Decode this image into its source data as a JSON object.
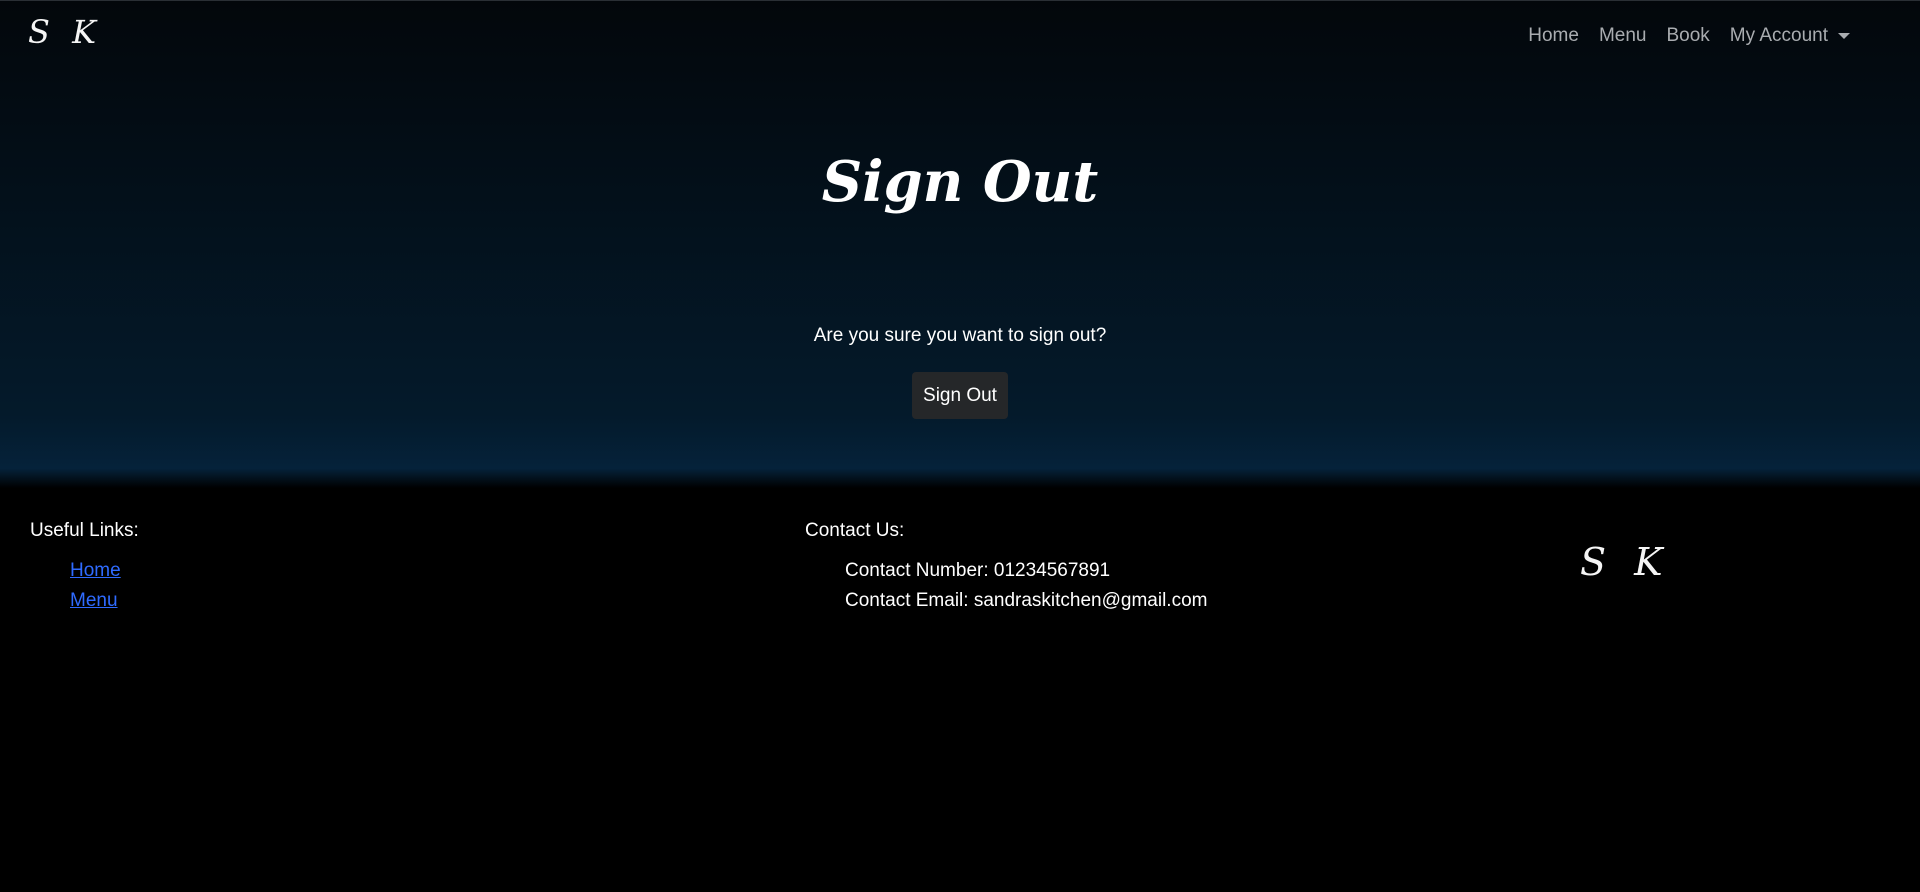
{
  "navbar": {
    "brand": "S K",
    "links": [
      "Home",
      "Menu",
      "Book"
    ],
    "account_label": "My Account"
  },
  "main": {
    "title": "Sign Out",
    "question": "Are you sure you want to sign out?",
    "button_label": "Sign Out"
  },
  "footer": {
    "useful_links_heading": "Useful Links:",
    "useful_links": [
      "Home",
      "Menu"
    ],
    "contact_heading": "Contact Us:",
    "contact_number": "Contact Number: 01234567891",
    "contact_email": "Contact Email: sandraskitchen@gmail.com",
    "brand": "S K"
  },
  "colors": {
    "link": "#2f6bff",
    "button_bg": "#252729",
    "nav_link": "#a9acb0"
  }
}
